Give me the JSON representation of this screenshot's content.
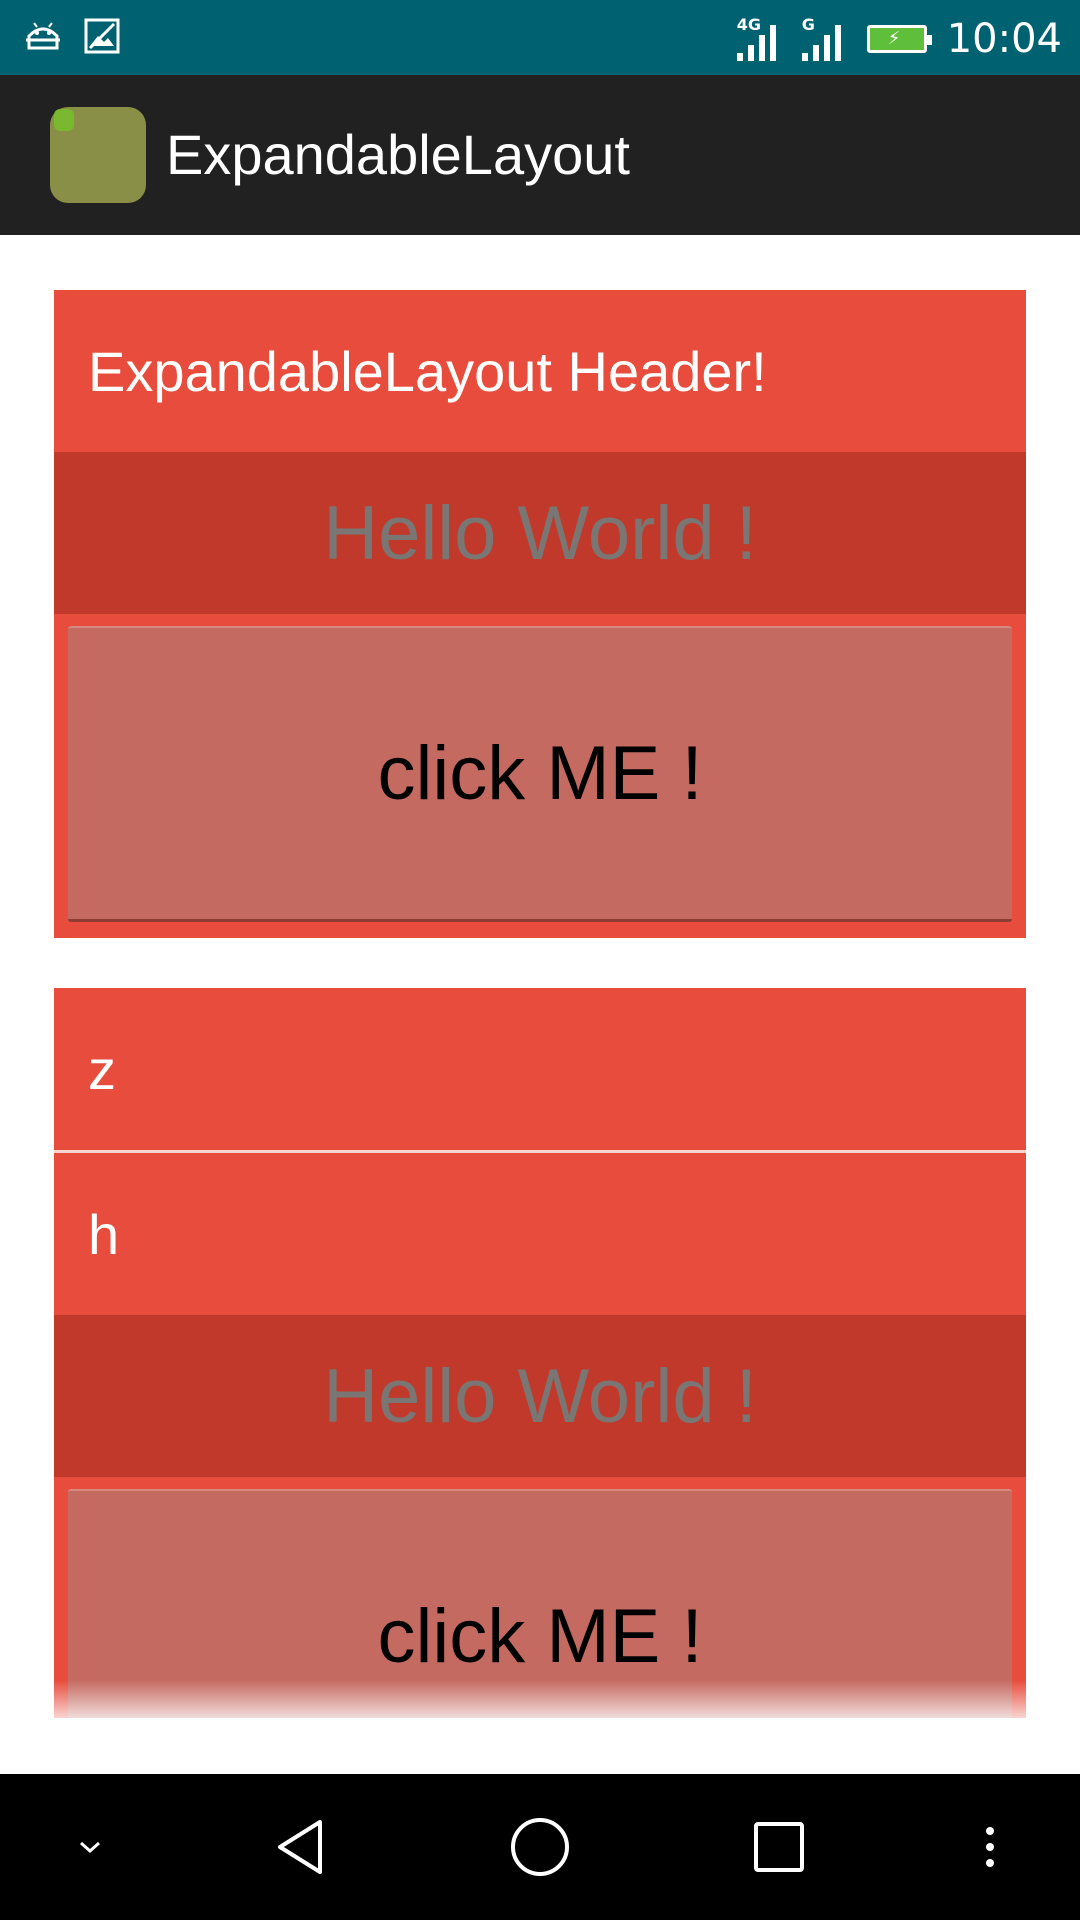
{
  "status_bar": {
    "network_1": "4G",
    "network_2": "G",
    "time": "10:04",
    "icons": [
      "android-debug-icon",
      "image-icon",
      "signal-icon",
      "battery-charging-icon"
    ]
  },
  "action_bar": {
    "title": "ExpandableLayout",
    "icon": "app-launcher-icon"
  },
  "cards": [
    {
      "headers": [
        "ExpandableLayout Header!"
      ],
      "content_text": "Hello World !",
      "button_label": "click ME !"
    },
    {
      "headers": [
        "z",
        "h"
      ],
      "content_text": "Hello World !",
      "button_label": "click ME !"
    }
  ],
  "nav_bar": {
    "icons": [
      "chevron-down-icon",
      "back-icon",
      "home-icon",
      "recents-icon",
      "more-vert-icon"
    ]
  },
  "colors": {
    "status_bar": "#006170",
    "action_bar": "#212121",
    "header_red": "#e74c3c",
    "content_dark_red": "#c0392b",
    "button": "#c56a61"
  }
}
